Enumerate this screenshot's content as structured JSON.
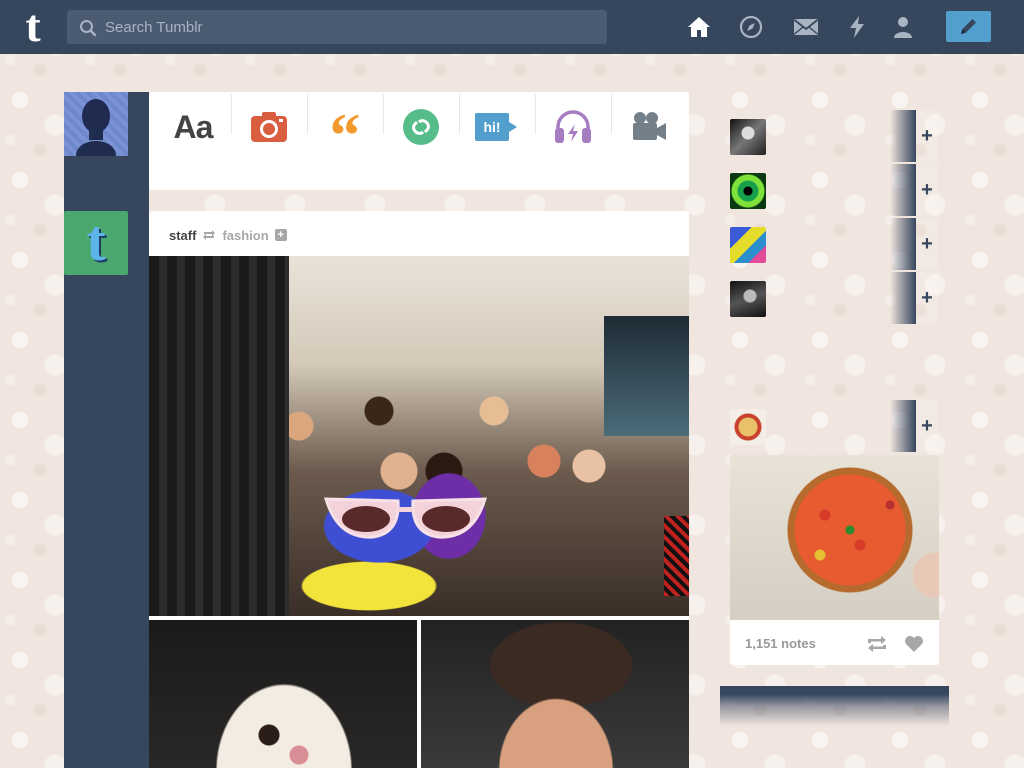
{
  "header": {
    "logo": "t",
    "search_placeholder": "Search Tumblr",
    "nav": [
      "home-icon",
      "explore-icon",
      "inbox-icon",
      "activity-icon",
      "account-icon"
    ],
    "compose_icon": "pencil-icon"
  },
  "post_types": [
    {
      "name": "text",
      "label": "Aa",
      "color": "#444444"
    },
    {
      "name": "photo",
      "icon": "camera-icon",
      "color": "#d95e40"
    },
    {
      "name": "quote",
      "label": "“",
      "color": "#f2992e"
    },
    {
      "name": "link",
      "icon": "link-icon",
      "color": "#56bc8a"
    },
    {
      "name": "chat",
      "label": "hi!",
      "color": "#529ecc"
    },
    {
      "name": "audio",
      "icon": "headphones-icon",
      "color": "#a77dc2"
    },
    {
      "name": "video",
      "icon": "video-camera-icon",
      "color": "#748089"
    }
  ],
  "post": {
    "author": "staff",
    "source": "fashion",
    "follow": "+"
  },
  "sidebar": {
    "recommended": [
      {
        "name": "",
        "sub": ""
      },
      {
        "name": "",
        "sub": ""
      },
      {
        "name": "",
        "sub": ""
      },
      {
        "name": "",
        "sub": ""
      }
    ],
    "radar": {
      "notes": "1,151 notes"
    },
    "follow_glyph": "+"
  },
  "colors": {
    "navy": "#36465d",
    "accent_blue": "#529ecc",
    "background": "#f1e5df"
  }
}
